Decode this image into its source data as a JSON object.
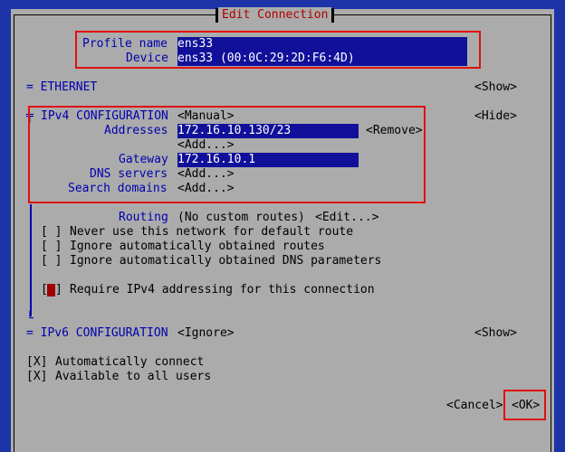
{
  "window": {
    "title": "Edit Connection"
  },
  "profile": {
    "name_label": "Profile name",
    "name_value": "ens33",
    "device_label": "Device",
    "device_value": "ens33 (00:0C:29:2D:F6:4D)"
  },
  "ethernet": {
    "label": "= ETHERNET",
    "toggle": "<Show>"
  },
  "ipv4": {
    "header_marker": "╤",
    "label": "IPv4 CONFIGURATION",
    "method": "<Manual>",
    "toggle": "<Hide>",
    "addresses_label": "Addresses",
    "address_value": "172.16.10.130/23",
    "remove_button": "<Remove>",
    "add_address_button": "<Add...>",
    "gateway_label": "Gateway",
    "gateway_value": "172.16.10.1",
    "dns_label": "DNS servers",
    "dns_add": "<Add...>",
    "search_label": "Search domains",
    "search_add": "<Add...>",
    "routing_label": "Routing",
    "routing_value": "(No custom routes)",
    "routing_edit": "<Edit...>",
    "checks": [
      {
        "box": "[ ]",
        "label": "Never use this network for default route"
      },
      {
        "box": "[ ]",
        "label": "Ignore automatically obtained routes"
      },
      {
        "box": "[ ]",
        "label": "Ignore automatically obtained DNS parameters"
      }
    ],
    "require": {
      "box_left": "[",
      "box_right": "]",
      "label": "Require IPv4 addressing for this connection"
    },
    "footer_marker": "└"
  },
  "ipv6": {
    "label": "= IPv6 CONFIGURATION",
    "method": "<Ignore>",
    "toggle": "<Show>"
  },
  "general": {
    "auto_connect": {
      "box": "[X]",
      "label": "Automatically connect"
    },
    "all_users": {
      "box": "[X]",
      "label": "Available to all users"
    }
  },
  "buttons": {
    "cancel": "<Cancel>",
    "ok": "<OK>"
  },
  "colors": {
    "background": "#1c34a8",
    "panel": "#ababab",
    "highlight": "#e01010",
    "field": "#10109a",
    "section": "#0000b0"
  }
}
